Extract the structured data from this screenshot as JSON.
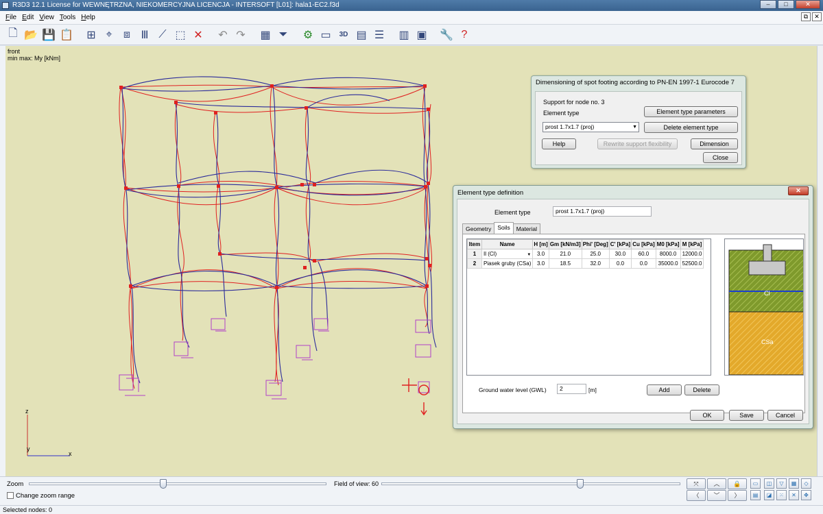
{
  "window": {
    "title": "R3D3 12.1 License for WEWNĘTRZNA, NIEKOMERCYJNA LICENCJA - INTERSOFT [L01]: hala1-EC2.f3d",
    "controls": {
      "minimize": "–",
      "maximize": "□",
      "close": "✕"
    }
  },
  "menu": {
    "items": [
      "File",
      "Edit",
      "View",
      "Tools",
      "Help"
    ]
  },
  "viewport": {
    "view_label": "front",
    "result_label": "min max: My [kNm]",
    "axis_z": "z",
    "axis_y": "y",
    "axis_x": "x",
    "colors": {
      "background": "#e3e2b8",
      "deformed": "#2a2a9a",
      "moment": "#e02020",
      "supports": "#b040c8"
    }
  },
  "bottom": {
    "zoom_label": "Zoom",
    "change_zoom_label": "Change zoom range",
    "fov_label": "Field of view: 60"
  },
  "status": {
    "selected_nodes": "Selected nodes: 0"
  },
  "footing_dialog": {
    "title": "Dimensioning of spot footing according to PN-EN 1997-1 Eurocode 7",
    "support_label": "Support for node no. 3",
    "element_type_label": "Element type",
    "element_type_params_btn": "Element type parameters",
    "element_type_value": "prost 1.7x1.7 (proj)",
    "delete_element_type_btn": "Delete element type",
    "help_btn": "Help",
    "rewrite_btn": "Rewrite support flexibility",
    "dimension_btn": "Dimension",
    "close_btn": "Close"
  },
  "element_dialog": {
    "title": "Element type definition",
    "element_type_label": "Element type",
    "element_type_value": "prost 1.7x1.7 (proj)",
    "tabs": [
      "Geometry",
      "Soils",
      "Material"
    ],
    "active_tab": "Soils",
    "columns": [
      "Item",
      "Name",
      "H [m]",
      "Gm [kN/m3]",
      "Phi' [Deg]",
      "C' [kPa]",
      "Cu [kPa]",
      "M0 [kPa]",
      "M [kPa]"
    ],
    "rows": [
      [
        "1",
        "Il (Cl)",
        "3.0",
        "21.0",
        "25.0",
        "30.0",
        "60.0",
        "8000.0",
        "12000.0"
      ],
      [
        "2",
        "Piasek gruby (CSa)",
        "3.0",
        "18.5",
        "32.0",
        "0.0",
        "0.0",
        "35000.0",
        "52500.0"
      ]
    ],
    "gwl_label": "Ground water level (GWL)",
    "gwl_value": "2",
    "gwl_unit": "[m]",
    "add_btn": "Add",
    "delete_btn": "Delete",
    "ok_btn": "OK",
    "save_btn": "Save",
    "cancel_btn": "Cancel",
    "preview": {
      "layer1_label": "Cl",
      "layer2_label": "CSa",
      "layer1_color": "#7f9a2c",
      "layer2_color": "#e3a92b",
      "gwl_color": "#1a3ed0"
    }
  }
}
